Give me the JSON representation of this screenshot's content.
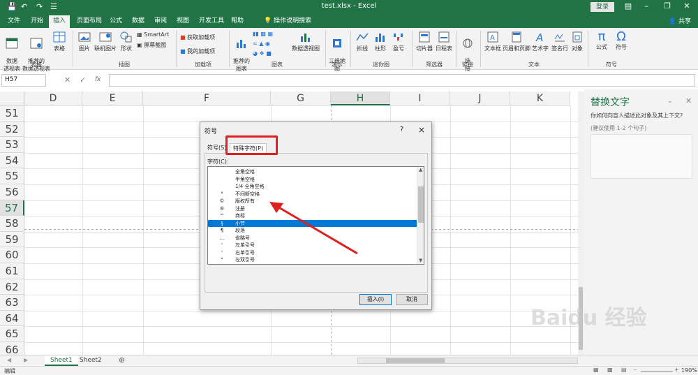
{
  "window": {
    "title": "test.xlsx - Excel",
    "login_label": "登录",
    "share_label": "共享"
  },
  "tabs": [
    "文件",
    "开始",
    "插入",
    "页面布局",
    "公式",
    "数据",
    "审阅",
    "视图",
    "开发工具",
    "帮助",
    "操作说明搜索"
  ],
  "active_tab": "插入",
  "ribbon": {
    "groups": {
      "tables": "表格",
      "illustrations": "插图",
      "addins": "加载项",
      "charts": "图表",
      "tours": "演示",
      "sparklines": "迷你图",
      "filters": "筛选器",
      "links": "链接",
      "text": "文本",
      "symbols": "符号"
    },
    "buttons": {
      "pivot": "数据\n透视表",
      "rec_pivot": "推荐的\n数据透视表",
      "table": "表格",
      "picture": "图片",
      "online_picture": "联机图片",
      "shapes": "形状",
      "smartart": "SmartArt",
      "screenshot": "屏幕截图",
      "get_addins": "获取加载项",
      "my_addins": "我的加载项",
      "rec_charts": "推荐的\n图表",
      "pivot_chart": "数据透视图",
      "map3d": "三维地\n图",
      "line": "折线",
      "column": "柱形",
      "winloss": "盈亏",
      "slicer": "切片器",
      "timeline": "日程表",
      "link": "链\n接",
      "textbox": "文本框",
      "header_footer": "页眉和页脚",
      "wordart": "艺术字",
      "signature": "签名行",
      "object": "对象",
      "equation": "公式",
      "symbol": "符号"
    }
  },
  "formula_bar": {
    "name_box": "H57",
    "fx": "fx",
    "value": ""
  },
  "grid": {
    "columns": [
      "D",
      "E",
      "F",
      "G",
      "H",
      "I",
      "J",
      "K"
    ],
    "selected_column": "H",
    "rows": [
      "51",
      "52",
      "53",
      "54",
      "55",
      "56",
      "57",
      "58",
      "59",
      "60",
      "61",
      "62",
      "63",
      "64",
      "65",
      "66"
    ],
    "selected_row": "57"
  },
  "pane": {
    "title": "替换文字",
    "question": "你如何向盲人描述此对象及其上下文?",
    "hint": "(建议使用 1-2 个句子)"
  },
  "sheets": [
    "Sheet1",
    "Sheet2"
  ],
  "active_sheet": "Sheet1",
  "status": {
    "mode": "编辑",
    "zoom": "190%"
  },
  "dialog": {
    "title": "符号",
    "help": "?",
    "close": "×",
    "tabs": [
      "符号(S)",
      "特殊字符(P)"
    ],
    "active_tab": "特殊字符(P)",
    "char_label": "字符(C):",
    "characters": [
      {
        "sym": "",
        "name": "全角空格"
      },
      {
        "sym": "",
        "name": "半角空格"
      },
      {
        "sym": "",
        "name": "1/4 全角空格"
      },
      {
        "sym": "°",
        "name": "不间断空格"
      },
      {
        "sym": "©",
        "name": "版权所有"
      },
      {
        "sym": "®",
        "name": "注册"
      },
      {
        "sym": "™",
        "name": "商标"
      },
      {
        "sym": "§",
        "name": "小节"
      },
      {
        "sym": "¶",
        "name": "段落"
      },
      {
        "sym": "...",
        "name": "省略号"
      },
      {
        "sym": "'",
        "name": "左单引号"
      },
      {
        "sym": "'",
        "name": "右单引号"
      },
      {
        "sym": "\"",
        "name": "左双引号"
      }
    ],
    "selected_index": 7,
    "insert_label": "插入(I)",
    "cancel_label": "取消"
  },
  "watermark": "Baidu 经验",
  "colors": {
    "excel_green": "#217346",
    "selection_blue": "#0078d7",
    "highlight_red": "#e02020"
  }
}
